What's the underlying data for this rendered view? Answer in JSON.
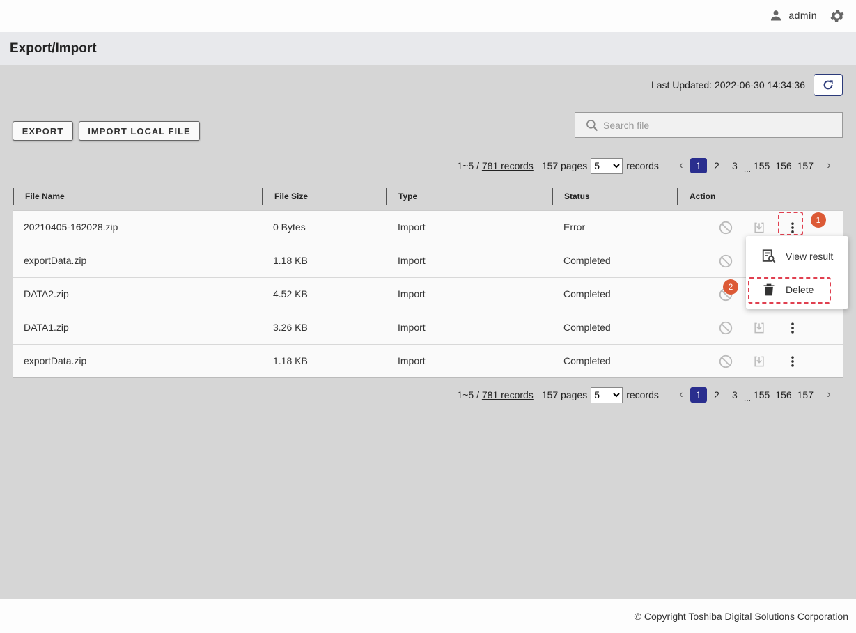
{
  "header": {
    "user_name": "admin",
    "user_icon": "person-icon",
    "settings_icon": "gear-icon"
  },
  "page": {
    "title": "Export/Import"
  },
  "status": {
    "last_updated": "Last Updated: 2022-06-30 14:34:36",
    "refresh_icon": "refresh-icon"
  },
  "toolbar": {
    "export_label": "EXPORT",
    "import_label": "IMPORT LOCAL FILE",
    "search_placeholder": "Search file"
  },
  "pagination": {
    "range": "1~5 / ",
    "records_link": "781 records",
    "pages": "157 pages",
    "page_size": "5",
    "records_suffix": "records",
    "page_numbers": [
      "1",
      "2",
      "3",
      "155",
      "156",
      "157"
    ],
    "ellipsis": "...",
    "active_page": "1"
  },
  "table": {
    "columns": [
      "File Name",
      "File Size",
      "Type",
      "Status",
      "Action"
    ],
    "rows": [
      {
        "file_name": "20210405-162028.zip",
        "file_size": "0 Bytes",
        "type": "Import",
        "status": "Error"
      },
      {
        "file_name": "exportData.zip",
        "file_size": "1.18 KB",
        "type": "Import",
        "status": "Completed"
      },
      {
        "file_name": "DATA2.zip",
        "file_size": "4.52 KB",
        "type": "Import",
        "status": "Completed"
      },
      {
        "file_name": "DATA1.zip",
        "file_size": "3.26 KB",
        "type": "Import",
        "status": "Completed"
      },
      {
        "file_name": "exportData.zip",
        "file_size": "1.18 KB",
        "type": "Import",
        "status": "Completed"
      }
    ]
  },
  "context_menu": {
    "items": [
      {
        "label": "View result",
        "icon": "view-result-icon"
      },
      {
        "label": "Delete",
        "icon": "trash-icon"
      }
    ]
  },
  "annotations": {
    "badge_1": "1",
    "badge_2": "2",
    "color": "#dc5a36"
  },
  "footer": {
    "copyright": "© Copyright Toshiba Digital Solutions Corporation"
  },
  "colors": {
    "accent": "#2a2e8e",
    "highlight": "#e04050"
  }
}
